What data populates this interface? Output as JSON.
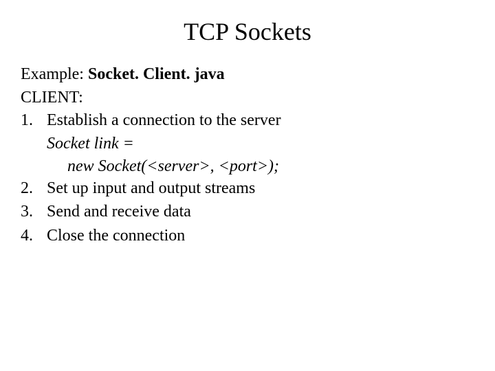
{
  "title": "TCP Sockets",
  "example": {
    "label": "Example:",
    "filename": "Socket. Client. java"
  },
  "role": "CLIENT:",
  "steps": [
    {
      "num": "1.",
      "text": "Establish a connection to the server",
      "code": {
        "line1": "Socket link =",
        "line2": "new Socket(<server>, <port>);"
      }
    },
    {
      "num": "2.",
      "text": "Set up input and output streams"
    },
    {
      "num": "3.",
      "text": "Send and receive data"
    },
    {
      "num": "4.",
      "text": "Close the connection"
    }
  ]
}
